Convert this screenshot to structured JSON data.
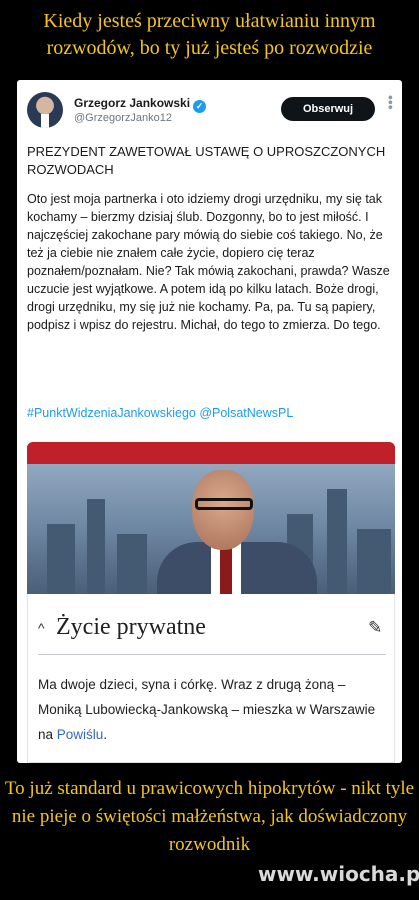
{
  "meme": {
    "title": "Kiedy jesteś przeciwny ułatwianiu innym rozwodów, bo ty już jesteś po rozwodzie",
    "caption": "To już standard u prawicowych hipokrytów - nikt tyle nie pieje o świętości małżeństwa, jak doświadczony rozwodnik",
    "watermark": "www.wiocha.pl"
  },
  "tweet": {
    "author_name": "Grzegorz Jankowski",
    "verified_badge": "✓",
    "handle": "@GrzegorzJanko12",
    "follow_label": "Obserwuj",
    "more_icon": "more-dots-icon",
    "headline": "PREZYDENT ZAWETOWAŁ USTAWĘ O UPROSZCZONYCH ROZWODACH",
    "body": "Oto jest moja partnerka i oto idziemy drogi urzędniku, my się tak kochamy – bierzmy dzisiaj ślub. Dozgonny, bo to jest miłość. I najczęściej zakochane pary mówią do siebie coś takiego. No, że też ja ciebie nie znałem całe życie, dopiero cię teraz poznałem/poznałam. Nie? Tak mówią zakochani, prawda? Wasze uczucie jest wyjątkowe. A potem idą po kilku latach. Boże drogi, drogi urzędniku, my się już nie kochamy. Pa, pa. Tu są papiery, podpisz i wpisz do rejestru. Michał, do tego to zmierza. Do tego.",
    "hashtags": "#PunktWidzeniaJankowskiego @PolsatNewsPL"
  },
  "wiki": {
    "section_title": "Życie prywatne",
    "caret_icon": "^",
    "edit_icon": "✎",
    "text_before_link": "Ma dwoje dzieci, syna i córkę. Wraz z drugą żoną – Moniką Lubowiecką-Jankowską – mieszka w Warszawie na ",
    "link_text": "Powiślu",
    "text_after_link": "."
  },
  "colors": {
    "meme_text": "#f5c518",
    "link_blue": "#1d9bf0",
    "wiki_link": "#3366cc"
  }
}
